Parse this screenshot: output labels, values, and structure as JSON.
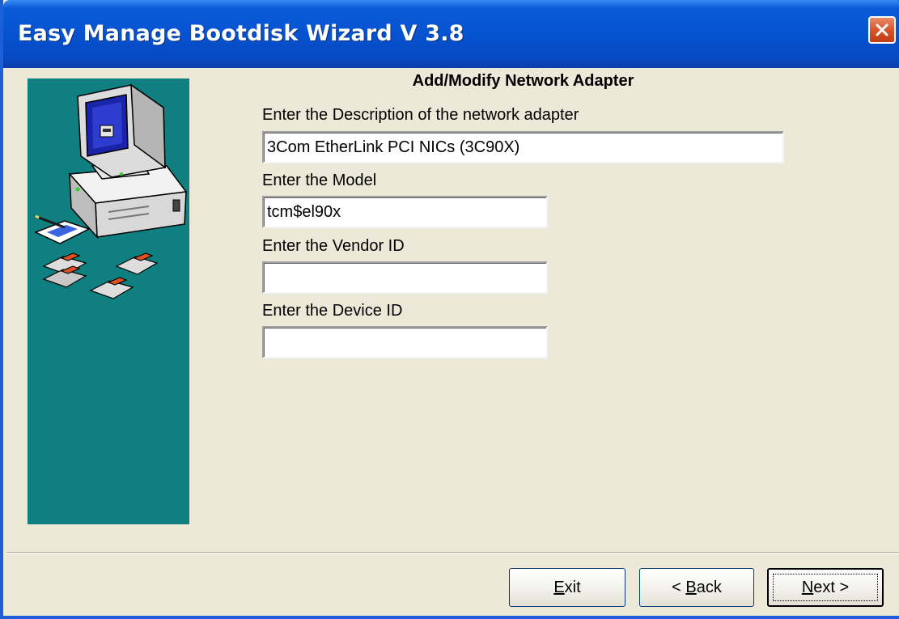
{
  "window": {
    "title": "Easy Manage Bootdisk Wizard V 3.8"
  },
  "page": {
    "heading": "Add/Modify Network Adapter",
    "fields": {
      "description": {
        "label": "Enter the Description of the network adapter",
        "value": "3Com EtherLink PCI NICs (3C90X)"
      },
      "model": {
        "label": "Enter the Model",
        "value": "tcm$el90x"
      },
      "vendor_id": {
        "label": "Enter the Vendor ID",
        "value": ""
      },
      "device_id": {
        "label": "Enter the Device ID",
        "value": ""
      }
    }
  },
  "buttons": {
    "exit": {
      "mnemonic": "E",
      "rest": "xit"
    },
    "back": {
      "prefix": "< ",
      "mnemonic": "B",
      "rest": "ack"
    },
    "next": {
      "mnemonic": "N",
      "rest": "ext >"
    }
  },
  "icons": {
    "close": "close-icon",
    "side_art": "computer-floppy-disks-illustration"
  },
  "colors": {
    "titlebar": "#0653d0",
    "side_panel": "#0f7f80",
    "dialog_background": "#ece9d8",
    "close_button": "#d8552c"
  }
}
